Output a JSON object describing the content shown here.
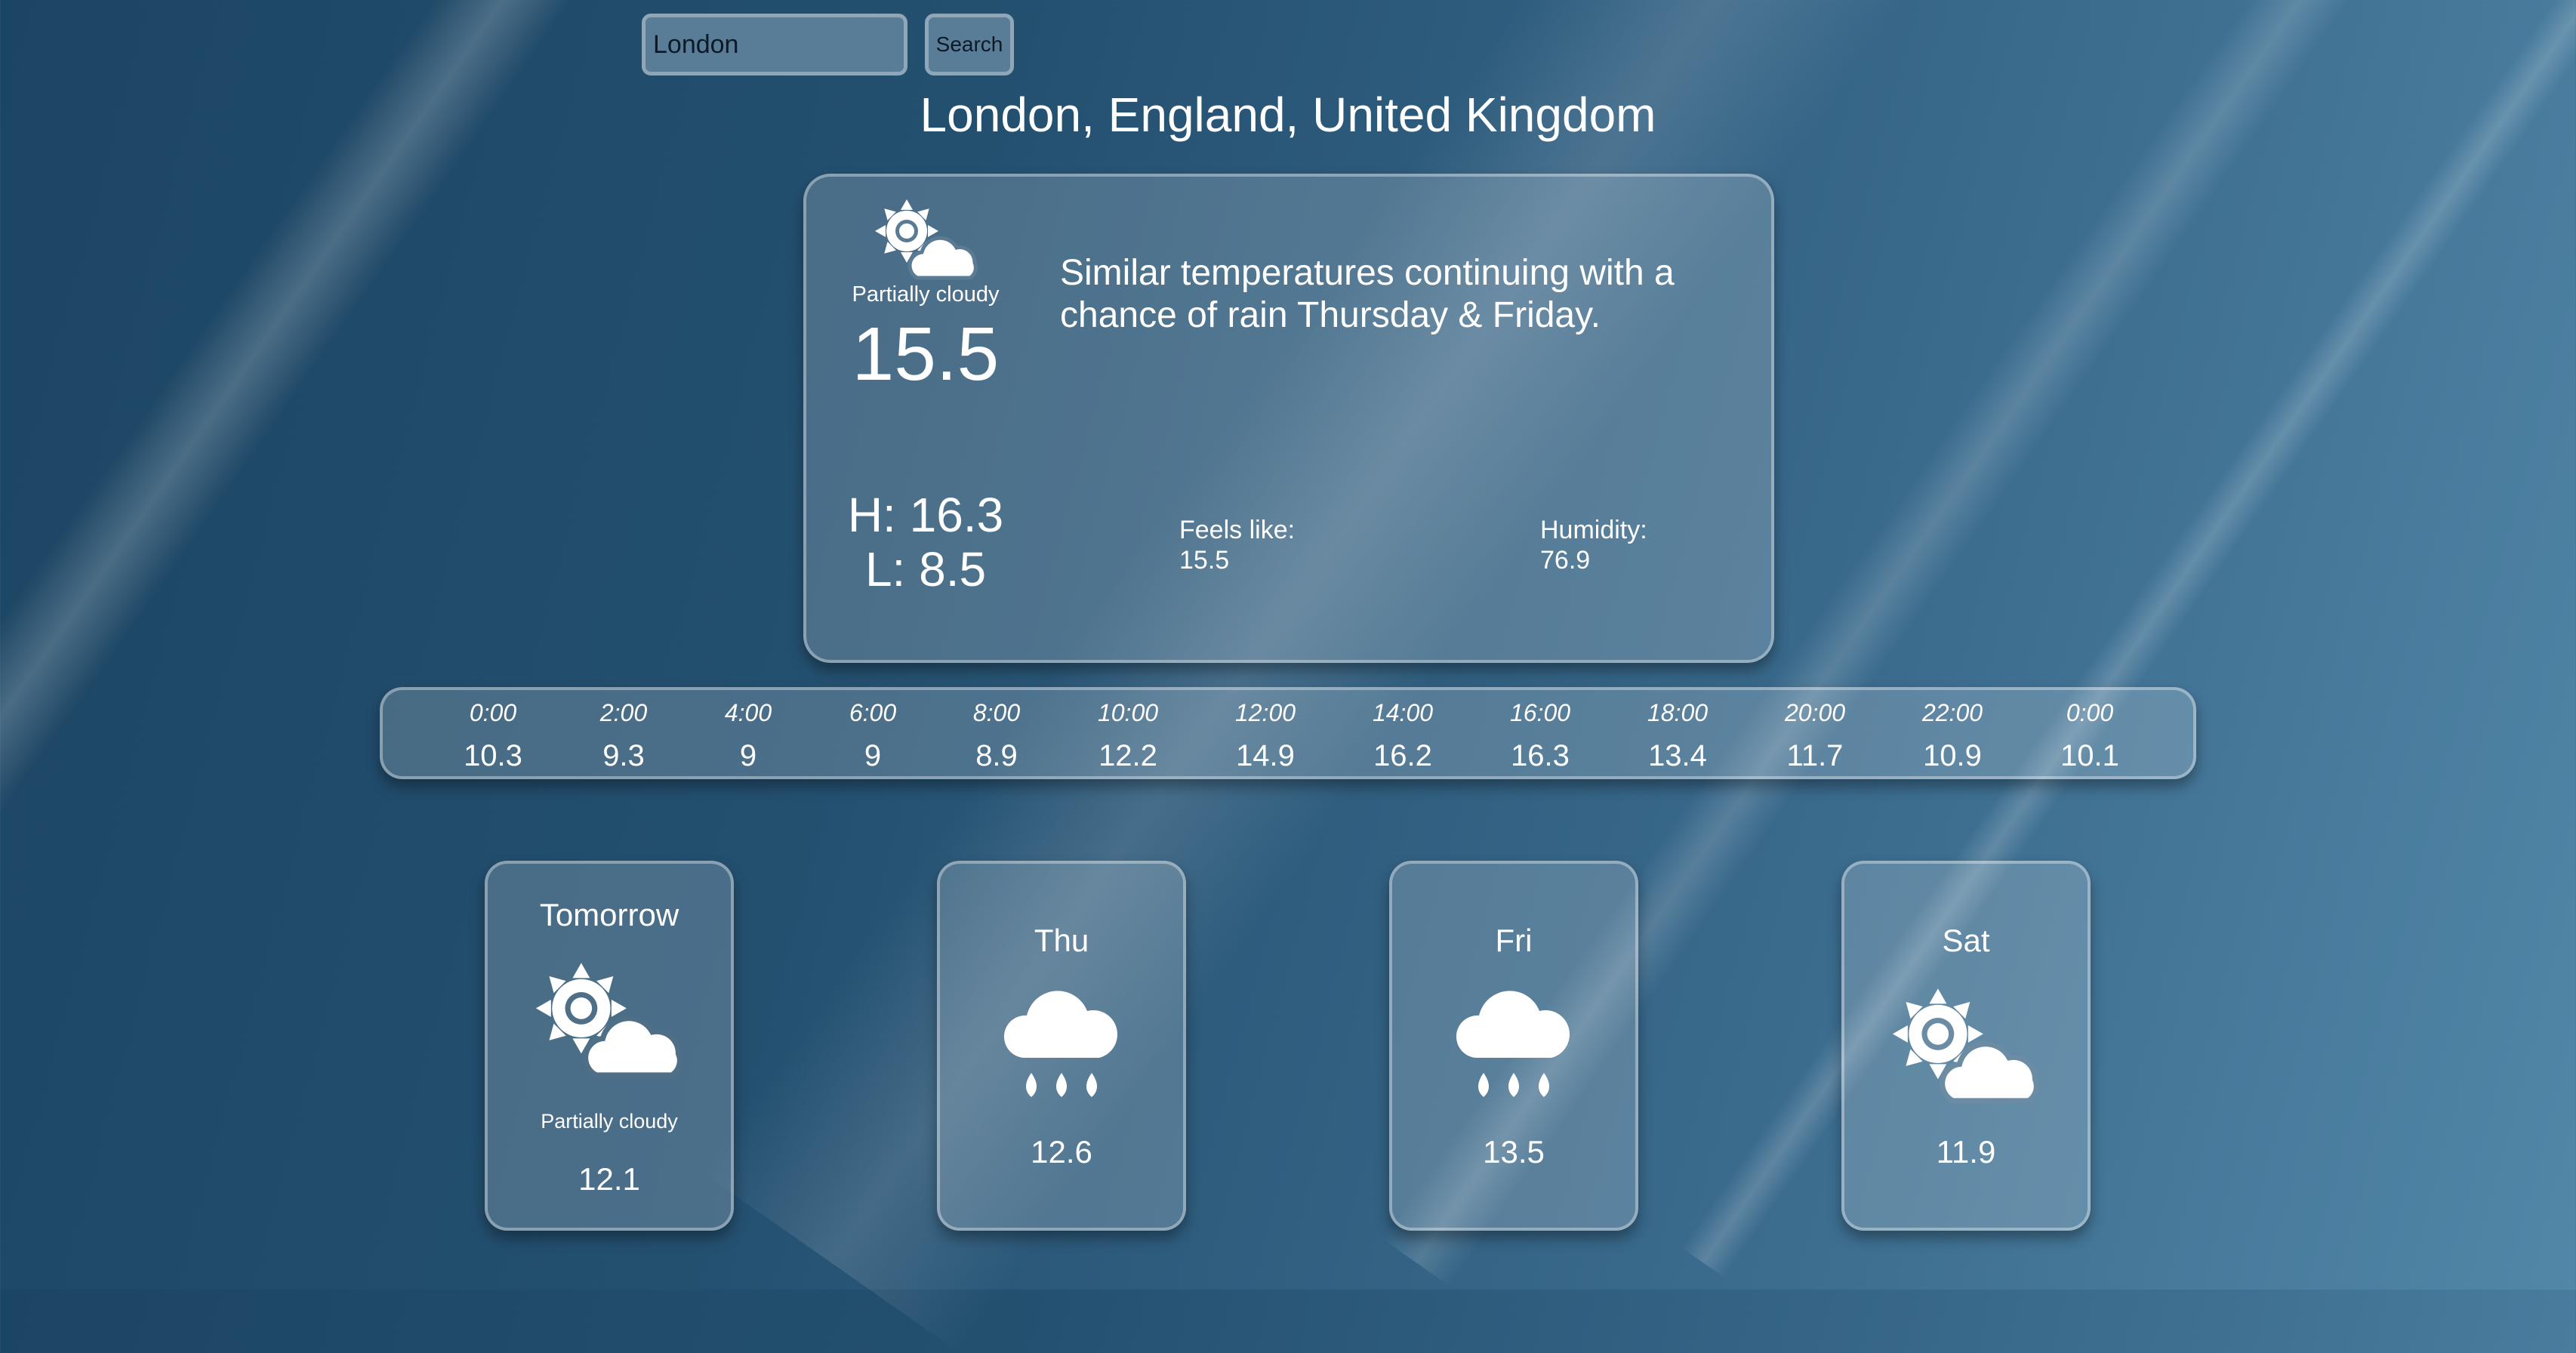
{
  "search": {
    "value": "London",
    "button_label": "Search"
  },
  "location": "London, England, United Kingdom",
  "current": {
    "icon": "partly-cloudy-icon",
    "condition": "Partially cloudy",
    "temp": "15.5",
    "description": "Similar temperatures continuing with a chance of rain Thursday & Friday.",
    "high": "H: 16.3",
    "low": "L: 8.5",
    "feels_like_label": "Feels like:",
    "feels_like": "15.5",
    "humidity_label": "Humidity:",
    "humidity": "76.9"
  },
  "hourly": [
    {
      "time": "0:00",
      "temp": "10.3"
    },
    {
      "time": "2:00",
      "temp": "9.3"
    },
    {
      "time": "4:00",
      "temp": "9"
    },
    {
      "time": "6:00",
      "temp": "9"
    },
    {
      "time": "8:00",
      "temp": "8.9"
    },
    {
      "time": "10:00",
      "temp": "12.2"
    },
    {
      "time": "12:00",
      "temp": "14.9"
    },
    {
      "time": "14:00",
      "temp": "16.2"
    },
    {
      "time": "16:00",
      "temp": "16.3"
    },
    {
      "time": "18:00",
      "temp": "13.4"
    },
    {
      "time": "20:00",
      "temp": "11.7"
    },
    {
      "time": "22:00",
      "temp": "10.9"
    },
    {
      "time": "0:00",
      "temp": "10.1"
    }
  ],
  "days": [
    {
      "name": "Tomorrow",
      "icon": "partly-cloudy-icon",
      "condition": "Partially cloudy",
      "temp": "12.1"
    },
    {
      "name": "Thu",
      "icon": "rain-icon",
      "temp": "12.6"
    },
    {
      "name": "Fri",
      "icon": "rain-icon",
      "temp": "13.5"
    },
    {
      "name": "Sat",
      "icon": "partly-cloudy-icon",
      "temp": "11.9"
    }
  ]
}
